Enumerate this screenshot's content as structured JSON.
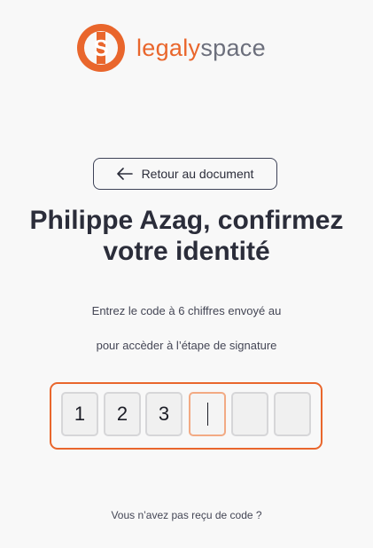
{
  "brand": {
    "name_part1": "legaly",
    "name_part2": "space",
    "mark_letter": "S",
    "accent_color": "#e9662c",
    "secondary_color": "#6c6f7c"
  },
  "back_button": {
    "label": "Retour au document",
    "icon": "arrow-left-icon"
  },
  "title": "Philippe Azag, confirmez votre identité",
  "subtitle_line1": "Entrez le code à 6 chiffres envoyé au",
  "subtitle_line2": "pour accèder à l’étape de signature",
  "code": {
    "length": 6,
    "digits": [
      "1",
      "2",
      "3",
      "",
      "",
      ""
    ],
    "active_index": 3
  },
  "resend_link": "Vous n’avez pas reçu de code ?"
}
